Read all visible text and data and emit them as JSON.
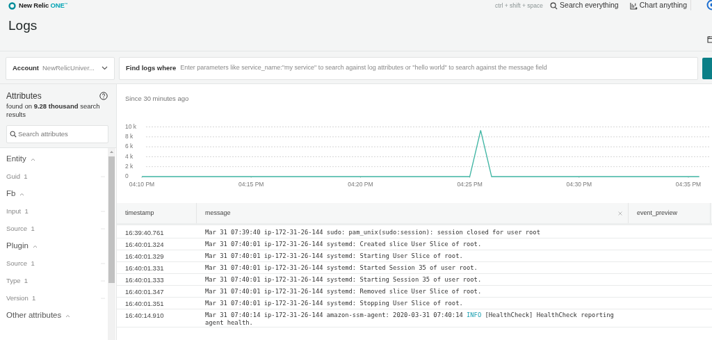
{
  "top_bar": {
    "brand": "New Relic",
    "brand_suffix": "ONE",
    "brand_mark": "™",
    "shortcut": "ctrl + shift + space",
    "search_label": "Search everything",
    "chart_label": "Chart anything"
  },
  "page_title": "Logs",
  "query_bar": {
    "account_label": "Account",
    "account_value": "NewRelicUniver...",
    "find_label": "Find logs where",
    "placeholder": "Enter parameters like service_name:\"my service\" to search against log attributes or \"hello world\" to search against the message field"
  },
  "attributes_panel": {
    "title": "Attributes",
    "summary": "found on **9.28 thousand** search results",
    "search_placeholder": "Search attributes",
    "groups": [
      {
        "label": "Entity",
        "expanded": true,
        "children": [
          {
            "label": "Guid",
            "count": "1"
          }
        ]
      },
      {
        "label": "Fb",
        "expanded": true,
        "children": [
          {
            "label": "Input",
            "count": "1"
          },
          {
            "label": "Source",
            "count": "1"
          }
        ]
      },
      {
        "label": "Plugin",
        "expanded": true,
        "children": [
          {
            "label": "Source",
            "count": "1"
          },
          {
            "label": "Type",
            "count": "1"
          },
          {
            "label": "Version",
            "count": "1"
          }
        ]
      },
      {
        "label": "Other attributes",
        "expanded": true
      }
    ]
  },
  "chart": {
    "subtitle": "Since 30 minutes ago",
    "chart_data": {
      "type": "line",
      "categories": [
        "04:10 PM",
        null,
        null,
        null,
        null,
        null,
        null,
        null,
        null,
        null,
        "04:15 PM",
        null,
        null,
        null,
        null,
        null,
        null,
        null,
        null,
        null,
        "04:20 PM",
        null,
        null,
        null,
        null,
        null,
        null,
        null,
        null,
        null,
        "04:25 PM",
        null,
        null,
        null,
        null,
        null,
        null,
        null,
        null,
        null,
        "04:30 PM",
        null,
        null,
        null,
        null,
        null,
        null,
        null,
        null,
        null,
        "04:35 PM",
        null
      ],
      "series": [
        {
          "color": "#3fb5a3",
          "values": [
            0,
            0,
            0,
            0,
            0,
            0,
            0,
            0,
            0,
            0,
            0,
            0,
            0,
            0,
            0,
            0,
            0,
            0,
            0,
            0,
            0,
            0,
            0,
            0,
            0,
            0,
            0,
            0,
            0,
            0,
            0,
            9300,
            0,
            0,
            0,
            0,
            0,
            0,
            0,
            0,
            0,
            0,
            0,
            0,
            0,
            0,
            0,
            0,
            0,
            0,
            0,
            0
          ]
        }
      ],
      "ylim": [
        0,
        10000
      ],
      "grid": true,
      "yticks": [
        {
          "value": 0,
          "label": "0"
        },
        {
          "value": 2000,
          "label": "2 k"
        },
        {
          "value": 4000,
          "label": "4 k"
        },
        {
          "value": 6000,
          "label": "6 k"
        },
        {
          "value": 8000,
          "label": "8 k"
        },
        {
          "value": 10000,
          "label": "10 k"
        }
      ]
    }
  },
  "table": {
    "columns": [
      "timestamp",
      "message",
      "event_preview"
    ],
    "rows": [
      {
        "timestamp": "16:39:40.761",
        "message": [
          {
            "kind": "text",
            "text": "Mar 31 07:39:40 ip-172-31-26-144 sudo: pam_unix(sudo:session): session closed for user root"
          }
        ]
      },
      {
        "timestamp": "16:40:01.324",
        "message": [
          {
            "kind": "text",
            "text": "Mar 31 07:40:01 ip-172-31-26-144 systemd: Created slice User Slice of root."
          }
        ]
      },
      {
        "timestamp": "16:40:01.329",
        "message": [
          {
            "kind": "text",
            "text": "Mar 31 07:40:01 ip-172-31-26-144 systemd: Starting User Slice of root."
          }
        ]
      },
      {
        "timestamp": "16:40:01.331",
        "message": [
          {
            "kind": "text",
            "text": "Mar 31 07:40:01 ip-172-31-26-144 systemd: Started Session 35 of user root."
          }
        ]
      },
      {
        "timestamp": "16:40:01.333",
        "message": [
          {
            "kind": "text",
            "text": "Mar 31 07:40:01 ip-172-31-26-144 systemd: Starting Session 35 of user root."
          }
        ]
      },
      {
        "timestamp": "16:40:01.347",
        "message": [
          {
            "kind": "text",
            "text": "Mar 31 07:40:01 ip-172-31-26-144 systemd: Removed slice User Slice of root."
          }
        ]
      },
      {
        "timestamp": "16:40:01.351",
        "message": [
          {
            "kind": "text",
            "text": "Mar 31 07:40:01 ip-172-31-26-144 systemd: Stopping User Slice of root."
          }
        ]
      },
      {
        "timestamp": "16:40:14.910",
        "message": [
          {
            "kind": "text",
            "text": "Mar 31 07:40:14 ip-172-31-26-144 amazon-ssm-agent: 2020-03-31 07:40:14 "
          },
          {
            "kind": "level",
            "text": "INFO"
          },
          {
            "kind": "text",
            "text": " [HealthCheck] HealthCheck reporting agent health."
          }
        ]
      }
    ]
  }
}
